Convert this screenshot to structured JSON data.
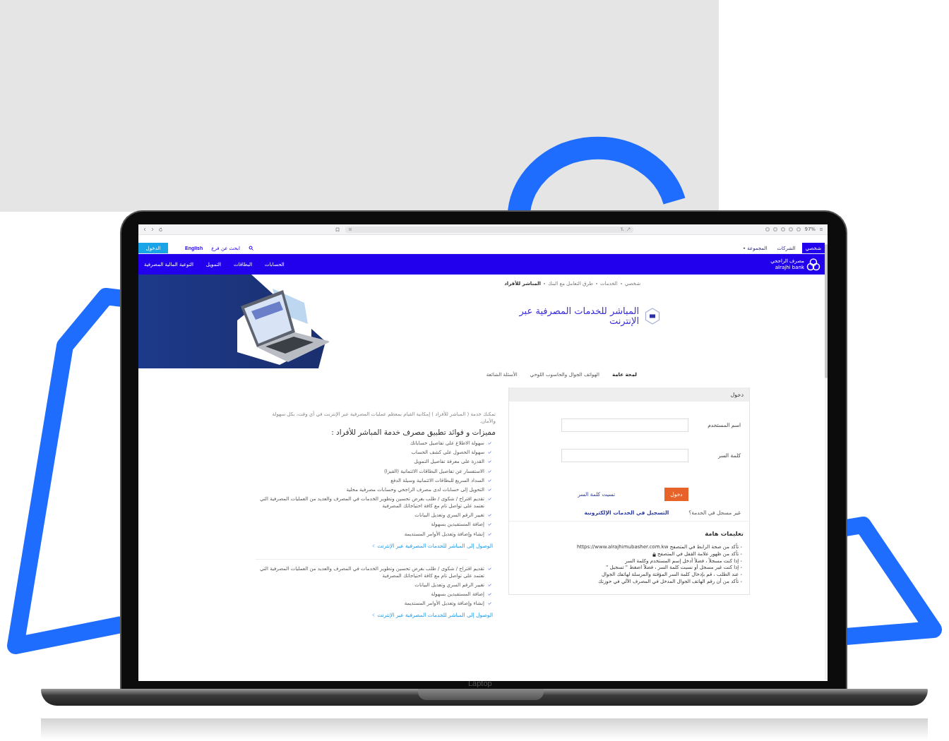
{
  "browser": {
    "zoom": "97%"
  },
  "top_bar": {
    "segments": [
      {
        "label": "شخصي",
        "selected": true
      },
      {
        "label": "الشركات",
        "selected": false
      },
      {
        "label": "المجموعة",
        "selected": false
      }
    ],
    "login_button": "الدخول",
    "language": "English",
    "branch_search": "ابحث عن فرع"
  },
  "main_nav": {
    "logo_ar": "مصرف الراجحي",
    "logo_en": "alrajhi bank",
    "items": [
      "الحسابات",
      "البطاقات",
      "التمويل",
      "التوعية المالية المصرفية"
    ]
  },
  "breadcrumb": [
    "شخصي",
    "الخدمات",
    "طرق التعامل مع البنك",
    "المباشر للأفراد"
  ],
  "page_title": "المباشر للخدمات المصرفية عبر الإنترنت",
  "tabs": [
    {
      "label": "لمحة عامة",
      "selected": true
    },
    {
      "label": "الهواتف الجوال والحاسوب اللوحي",
      "selected": false
    },
    {
      "label": "الأسئلة الشائعة",
      "selected": false
    }
  ],
  "features": {
    "intro": "تمكنك خدمة ( المباشر للأفراد ) إمكانية القيام بمعظم عمليات المصرفية عبر الإنترنت في أي وقت، بكل سهولة والأمان.",
    "heading": "مميزات و فوائد تطبيق مصرف خدمة المباشر للأفراد :",
    "items": [
      "سهولة الاطلاع على تفاصيل حساباتك",
      "سهولة الحصول على كشف الحساب",
      "القدرة على معرفة تفاصيل التمويل",
      "الاستفسار عن تفاصيل البطاقات الائتمانية (الفيزا)",
      "السداد السريع للبطاقات الائتمانية وسيلة الدفع",
      "التحويل إلى حسابات لدى مصرف الراجحي وحسابات مصرفية محلية",
      "تقديم اقتراح / شكوى / طلب بغرض تحسين وتطوير الخدمات في المصرف والعديد من العمليات المصرفية التي تعتمد على تواصل تام مع كافة احتياجاتك المصرفية",
      "تغيير الرقم السري وتعديل البيانات",
      "إضافة المستفيدين بسهولة",
      "إنشاء وإضافة وتعديل الأوامر المستديمة"
    ],
    "link": "الوصول إلى المباشر للخدمات المصرفية عبر الإنترنت"
  },
  "features_more": {
    "items": [
      "تقديم اقتراح / شكوى / طلب بغرض تحسين وتطوير الخدمات في المصرف والعديد من العمليات المصرفية التي تعتمد على تواصل تام مع كافة احتياجاتك المصرفية",
      "تغيير الرقم السري وتعديل البيانات",
      "إضافة المستفيدين بسهولة",
      "إنشاء وإضافة وتعديل الأوامر المستديمة"
    ],
    "link": "الوصول إلى المباشر للخدمات المصرفية عبر الإنترنت"
  },
  "login": {
    "title": "دخول",
    "username_label": "اسم المستخدم",
    "password_label": "كلمة السر",
    "submit": "دخول",
    "forgot": "نسيت كلمة السر",
    "not_registered": "غير مسجل في الخدمة؟",
    "register": "التسجيل في الخدمات الإلكترونية"
  },
  "instructions": {
    "title": "تعليمات هامة",
    "lines": [
      {
        "text": "- تأكد من صحة الرابط في المتصفح https://www.alrajhimubasher.com.kw",
        "lock": false
      },
      {
        "text": "- تأكد من ظهور علامة القفل في المتصفح",
        "lock": true
      },
      {
        "text": "- إذا كنت مسجلاً ، فضلاً أدخل إسم المستخدم وكلمة السر",
        "lock": false
      },
      {
        "text": "- إذا كنت غير مسجل أو نسيت كلمة السر ، فضلاً اضغط \" تسجيل \"",
        "lock": false
      },
      {
        "text": "- عند الطلب ، قم بإدخال كلمة السر المؤقتة والمرسلة لهاتفك الجوال",
        "lock": false
      },
      {
        "text": "- تأكد من أن رقم الهاتف الجوال المدخل في المصرف الآلي في حوزتك",
        "lock": false
      }
    ]
  },
  "device_label": "Laptop"
}
